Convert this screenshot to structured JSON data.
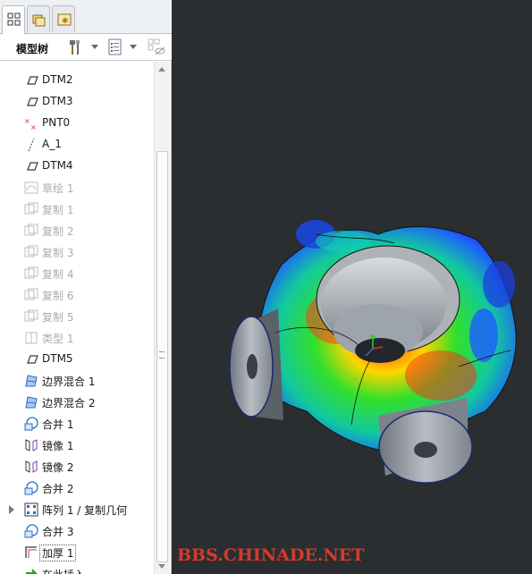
{
  "panel": {
    "title": "模型树",
    "tabs": [
      {
        "name": "model-tree-tab",
        "active": true
      },
      {
        "name": "folder-browser-tab",
        "active": false
      },
      {
        "name": "favorites-tab",
        "active": false
      }
    ]
  },
  "tree": {
    "items": [
      {
        "label": "DTM2",
        "icon": "datum-plane-icon",
        "dimmed": false
      },
      {
        "label": "DTM3",
        "icon": "datum-plane-icon",
        "dimmed": false
      },
      {
        "label": "PNT0",
        "icon": "datum-point-icon",
        "dimmed": false
      },
      {
        "label": "A_1",
        "icon": "datum-axis-icon",
        "dimmed": false
      },
      {
        "label": "DTM4",
        "icon": "datum-plane-icon",
        "dimmed": false
      },
      {
        "label": "草绘 1",
        "icon": "sketch-icon",
        "dimmed": true
      },
      {
        "label": "复制 1",
        "icon": "copy-icon",
        "dimmed": true
      },
      {
        "label": "复制 2",
        "icon": "copy-icon",
        "dimmed": true
      },
      {
        "label": "复制 3",
        "icon": "copy-icon",
        "dimmed": true
      },
      {
        "label": "复制 4",
        "icon": "copy-icon",
        "dimmed": true
      },
      {
        "label": "复制 6",
        "icon": "copy-icon",
        "dimmed": true
      },
      {
        "label": "复制 5",
        "icon": "copy-icon",
        "dimmed": true
      },
      {
        "label": "类型 1",
        "icon": "type-icon",
        "dimmed": true
      },
      {
        "label": "DTM5",
        "icon": "datum-plane-icon",
        "dimmed": false
      },
      {
        "label": "边界混合 1",
        "icon": "boundary-blend-icon",
        "dimmed": false
      },
      {
        "label": "边界混合 2",
        "icon": "boundary-blend-icon",
        "dimmed": false
      },
      {
        "label": "合并 1",
        "icon": "merge-icon",
        "dimmed": false
      },
      {
        "label": "镜像 1",
        "icon": "mirror-icon",
        "dimmed": false
      },
      {
        "label": "镜像 2",
        "icon": "mirror-icon",
        "dimmed": false
      },
      {
        "label": "合并 2",
        "icon": "merge-icon",
        "dimmed": false
      },
      {
        "label": "阵列 1 / 复制几何",
        "icon": "pattern-icon",
        "dimmed": false,
        "expandable": true
      },
      {
        "label": "合并 3",
        "icon": "merge-icon",
        "dimmed": false
      },
      {
        "label": "加厚 1",
        "icon": "thicken-icon",
        "dimmed": false,
        "selected": true
      },
      {
        "label": "在此插入",
        "icon": "insert-here-arrow-icon",
        "dimmed": false
      }
    ]
  },
  "watermark": "BBS.CHINADE.NET",
  "colors": {
    "viewport_bg": "#2b2e31",
    "model_gray": "#9aa0a8",
    "watermark": "#d63a2a"
  }
}
